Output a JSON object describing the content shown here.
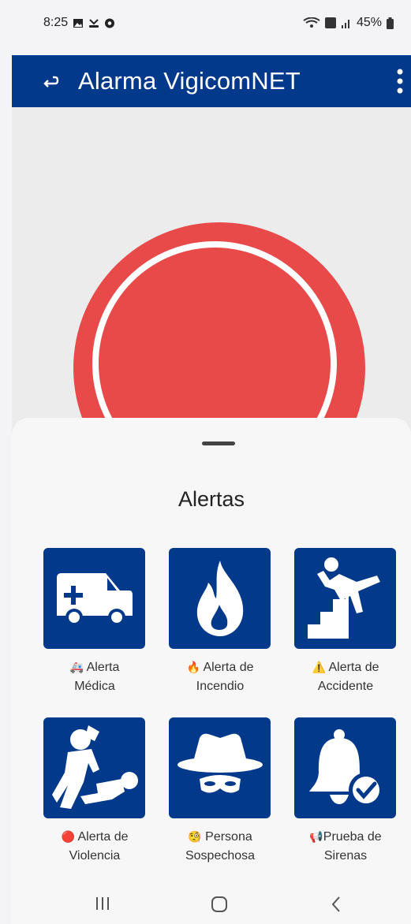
{
  "status": {
    "time": "8:25",
    "battery": "45%"
  },
  "appbar": {
    "title": "Alarma VigicomNET"
  },
  "sheet": {
    "title": "Alertas",
    "alerts": [
      {
        "emoji": "🚑",
        "line1": "Alerta",
        "line2": "Médica",
        "icon": "ambulance-icon"
      },
      {
        "emoji": "🔥",
        "line1": "Alerta de",
        "line2": "Incendio",
        "icon": "fire-icon"
      },
      {
        "emoji": "⚠️",
        "line1": "Alerta de",
        "line2": "Accidente",
        "icon": "falling-person-icon"
      },
      {
        "emoji": "🔴",
        "line1": "Alerta de",
        "line2": "Violencia",
        "icon": "fight-icon"
      },
      {
        "emoji": "🧐",
        "line1": "Persona",
        "line2": "Sospechosa",
        "icon": "spy-icon"
      },
      {
        "emoji": "📢",
        "line1": "Prueba de",
        "line2": "Sirenas",
        "icon": "bell-check-icon"
      }
    ]
  },
  "colors": {
    "primary": "#03398a",
    "alarm": "#e84a4a"
  }
}
